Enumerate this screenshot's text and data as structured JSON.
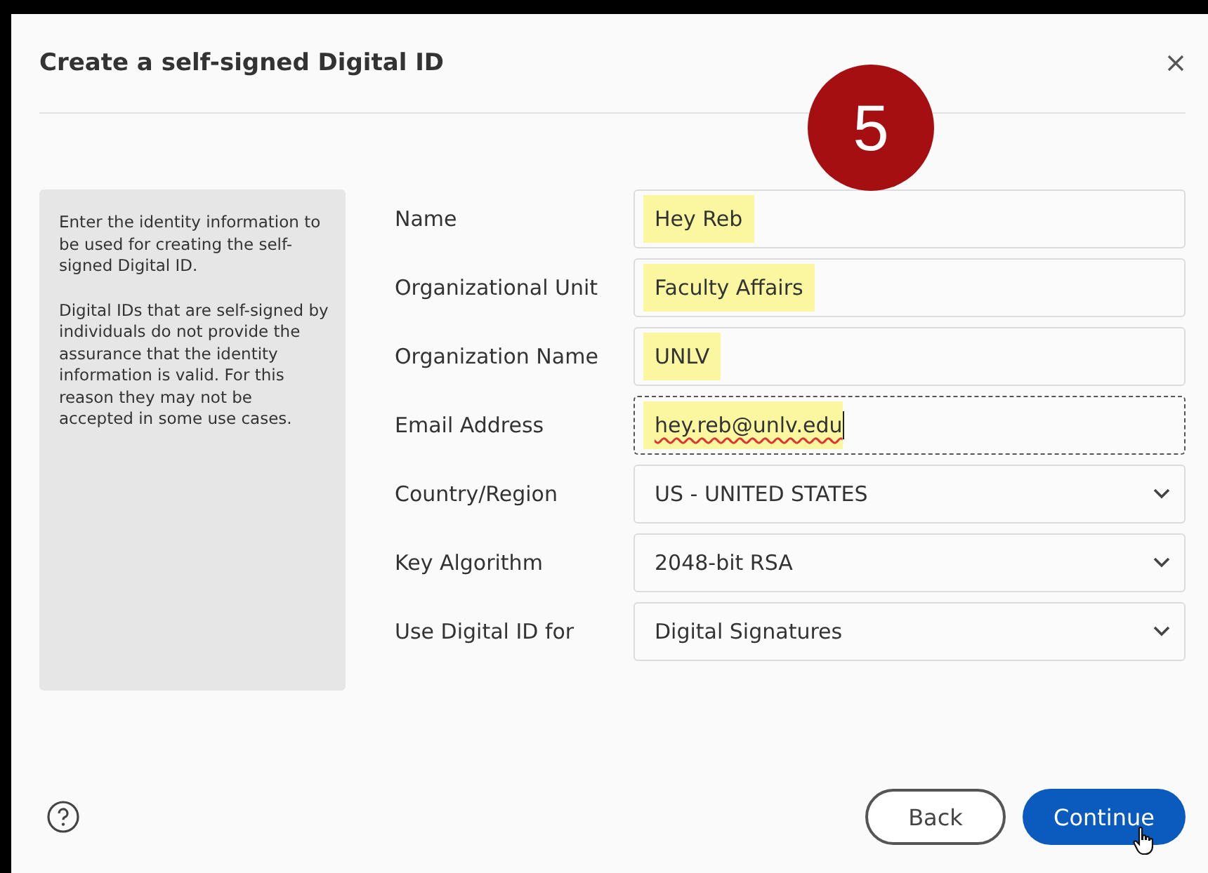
{
  "dialog": {
    "title": "Create a self-signed Digital ID"
  },
  "step_badge": "5",
  "info_panel": {
    "paragraphs": [
      "Enter the identity information to be used for creating the self-signed Digital ID.",
      "Digital IDs that are self-signed by individuals do not provide the assurance that the identity information is valid. For this reason they may not be accepted in some use cases."
    ]
  },
  "fields": [
    {
      "label": "Name",
      "kind": "text",
      "value": "Hey Reb",
      "highlighted": true,
      "focused": false
    },
    {
      "label": "Organizational Unit",
      "kind": "text",
      "value": "Faculty Affairs",
      "highlighted": true,
      "focused": false
    },
    {
      "label": "Organization Name",
      "kind": "text",
      "value": "UNLV",
      "highlighted": true,
      "focused": false
    },
    {
      "label": "Email Address",
      "kind": "text",
      "value": "hey.reb@unlv.edu",
      "highlighted": true,
      "focused": true
    },
    {
      "label": "Country/Region",
      "kind": "select",
      "value": "US - UNITED STATES",
      "highlighted": false,
      "focused": false
    },
    {
      "label": "Key Algorithm",
      "kind": "select",
      "value": "2048-bit RSA",
      "highlighted": false,
      "focused": false
    },
    {
      "label": "Use Digital ID for",
      "kind": "select",
      "value": "Digital Signatures",
      "highlighted": false,
      "focused": false
    }
  ],
  "buttons": [
    {
      "label": "Back",
      "kind": "secondary"
    },
    {
      "label": "Continue",
      "kind": "primary"
    }
  ]
}
